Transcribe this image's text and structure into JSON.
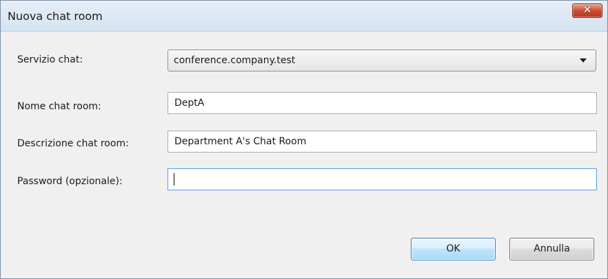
{
  "window": {
    "title": "Nuova chat room",
    "close_glyph": "✕"
  },
  "form": {
    "service": {
      "label": "Servizio chat:",
      "value": "conference.company.test"
    },
    "name": {
      "label": "Nome chat room:",
      "value": "DeptA"
    },
    "description": {
      "label": "Descrizione chat room:",
      "value": "Department A's Chat Room"
    },
    "password": {
      "label": "Password (opzionale):",
      "value": ""
    }
  },
  "buttons": {
    "ok": "OK",
    "cancel": "Annulla"
  },
  "colors": {
    "title_bar": "#dbe6f3",
    "close_button": "#c7492d",
    "focus_border": "#569de5",
    "ok_button": "#bee6fd"
  },
  "icons": {
    "close": "close-icon",
    "dropdown": "chevron-down-icon"
  }
}
